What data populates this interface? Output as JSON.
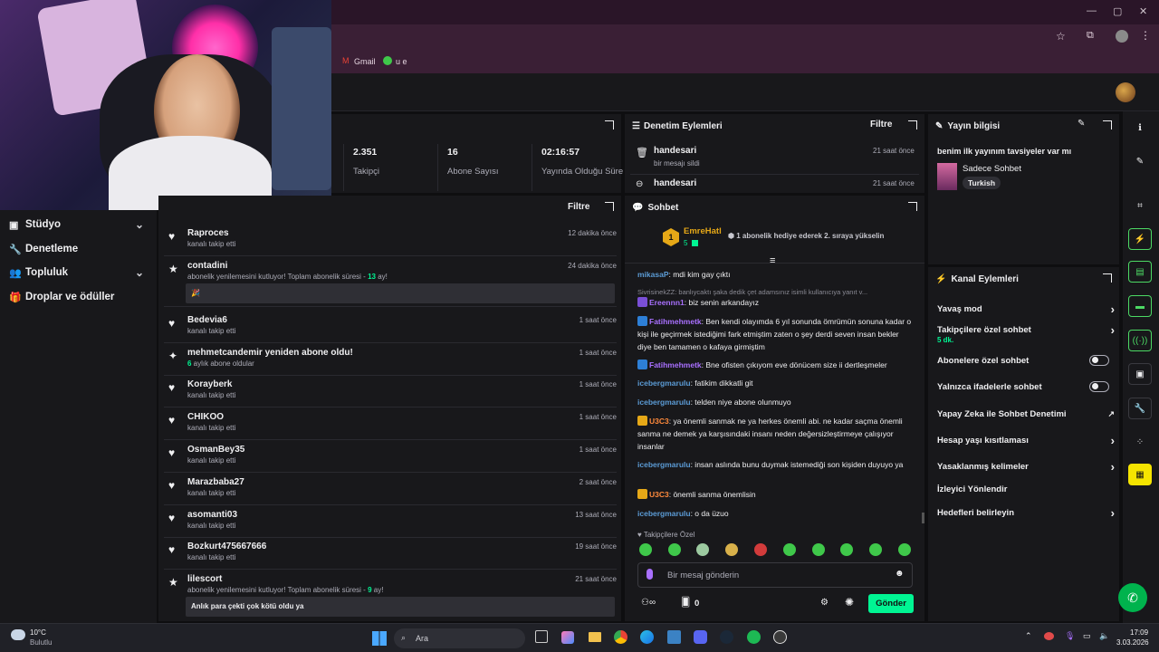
{
  "browser": {
    "bookmarks": [
      "Gmail",
      "u e"
    ]
  },
  "colors": {
    "accent": "#a970ff",
    "green": "#00f593",
    "bg": "#0e0e10",
    "panel": "#18181b"
  },
  "nav": [
    {
      "label": "Stüdyo",
      "icon": "studio-icon",
      "chevron": true
    },
    {
      "label": "Denetleme",
      "icon": "wrench-icon",
      "chevron": false
    },
    {
      "label": "Topluluk",
      "icon": "community-icon",
      "chevron": true
    },
    {
      "label": "Droplar ve ödüller",
      "icon": "gift-icon",
      "chevron": false
    }
  ],
  "stats": [
    {
      "value": "2.351",
      "label": "Takipçi"
    },
    {
      "value": "16",
      "label": "Abone Sayısı"
    },
    {
      "value": "02:16:57",
      "label": "Yayında Olduğu Süre"
    }
  ],
  "activity": {
    "filter": "Filtre",
    "items": [
      {
        "name": "Raproces",
        "sub": "kanalı takip etti",
        "time": "12 dakika önce",
        "icon": "heart-icon"
      },
      {
        "name": "contadini",
        "sub": "abonelik yenilemesini kutluyor! Toplam abonelik süresi - ",
        "sub_num": "13",
        "sub_end": " ay!",
        "time": "24 dakika önce",
        "icon": "star-icon",
        "msg": "🎉"
      },
      {
        "name": "Bedevia6",
        "sub": "kanalı takip etti",
        "time": "1 saat önce",
        "icon": "heart-icon"
      },
      {
        "name": "mehmetcandemir yeniden abone oldu!",
        "sub_num": "6",
        "sub": " aylık abone oldular",
        "time": "1 saat önce",
        "icon": "sparkle-icon"
      },
      {
        "name": "Korayberk",
        "sub": "kanalı takip etti",
        "time": "1 saat önce",
        "icon": "heart-icon"
      },
      {
        "name": "CHIKOO",
        "sub": "kanalı takip etti",
        "time": "1 saat önce",
        "icon": "heart-icon"
      },
      {
        "name": "OsmanBey35",
        "sub": "kanalı takip etti",
        "time": "1 saat önce",
        "icon": "heart-icon"
      },
      {
        "name": "Marazbaba27",
        "sub": "kanalı takip etti",
        "time": "2 saat önce",
        "icon": "heart-icon"
      },
      {
        "name": "asomanti03",
        "sub": "kanalı takip etti",
        "time": "13 saat önce",
        "icon": "heart-icon"
      },
      {
        "name": "Bozkurt475667666",
        "sub": "kanalı takip etti",
        "time": "19 saat önce",
        "icon": "heart-icon"
      },
      {
        "name": "lilescort",
        "sub": "abonelik yenilemesini kutluyor! Toplam abonelik süresi - ",
        "sub_num": "9",
        "sub_end": " ay!",
        "time": "21 saat önce",
        "icon": "star-icon",
        "msg": "Anlık para çekti çok kötü oldu ya"
      }
    ]
  },
  "moderation": {
    "title": "Denetim Eylemleri",
    "filter": "Filtre",
    "items": [
      {
        "name": "handesari",
        "sub": "bir mesajı sildi",
        "time": "21 saat önce"
      },
      {
        "name": "handesari",
        "sub": "",
        "time": "21 saat önce"
      }
    ]
  },
  "chat": {
    "title": "Sohbet",
    "gift_user": "EmreHatl",
    "gift_rank": "1",
    "gift_count": "5",
    "gift_text": "1 abonelik hediye ederek 2. sıraya yükselin",
    "messages": [
      {
        "user": "mikasaP",
        "cls": "u-blue",
        "text": ": mdi kim gay çıktı"
      },
      {
        "user": "",
        "cls": "muted",
        "text": "SivrisinekZZ: banlıycaktı şaka dedik çet adamsınız isimli kullanıcıya yanıt v..."
      },
      {
        "user": "Ereennn1",
        "cls": "u-purple",
        "text": ": biz senin arkandayız"
      },
      {
        "user": "Fatihmehmetk",
        "cls": "u-purple",
        "text": ": Ben kendi olayımda 6 yıl sonunda ömrümün sonuna kadar o kişi ile geçirmek istediğimi fark etmiştim zaten o şey derdi seven insan bekler diye ben tamamen o kafaya girmiştim"
      },
      {
        "user": "Fatihmehmetk",
        "cls": "u-purple",
        "text": ": Bne ofisten çıkıyom eve dönücem size ii dertleşmeler"
      },
      {
        "user": "icebergmarulu",
        "cls": "u-blue",
        "text": ": fatikim dikkatli git"
      },
      {
        "user": "icebergmarulu",
        "cls": "u-blue",
        "text": ": telden niye abone olunmuyo"
      },
      {
        "user": "U3C3",
        "cls": "u-orange",
        "text": ": ya önemli sanmak ne ya herkes önemli abi. ne kadar saçma önemli sanma ne demek ya karşısındaki insanı neden değersizleştirmeye çalışıyor insanlar"
      },
      {
        "user": "icebergmarulu",
        "cls": "u-blue",
        "text": ": insan aslında bunu duymak istemediği son kişiden duyuyo ya"
      },
      {
        "user": "U3C3",
        "cls": "u-orange",
        "text": ": önemli sanma önemlisin"
      },
      {
        "user": "icebergmarulu",
        "cls": "u-blue",
        "text": ": o da üzuo"
      }
    ],
    "followers_only": "Takipçilere Özel",
    "input_placeholder": "Bir mesaj gönderin",
    "points": "0",
    "send_label": "Gönder"
  },
  "stream_info": {
    "title": "Yayın bilgisi",
    "stream_title": "benim ilk yayınım tavsiyeler var mı",
    "category": "Sadece Sohbet",
    "tag": "Turkish"
  },
  "channel_actions": {
    "title": "Kanal Eylemleri",
    "items": [
      {
        "label": "Yavaş mod",
        "control": "chevron"
      },
      {
        "label": "Takipçilere özel sohbet",
        "sub": "5 dk.",
        "control": "chevron"
      },
      {
        "label": "Abonelere özel sohbet",
        "control": "toggle"
      },
      {
        "label": "Yalnızca ifadelerle sohbet",
        "control": "toggle"
      },
      {
        "label": "Yapay Zeka ile Sohbet Denetimi",
        "control": "external"
      },
      {
        "label": "Hesap yaşı kısıtlaması",
        "control": "chevron"
      },
      {
        "label": "Yasaklanmış kelimeler",
        "control": "chevron"
      },
      {
        "label": "İzleyici Yönlendir",
        "control": "none"
      },
      {
        "label": "Hedefleri belirleyin",
        "control": "chevron"
      }
    ]
  },
  "taskbar": {
    "weather_temp": "10°C",
    "weather_text": "Bulutlu",
    "search": "Ara",
    "time": "17:09",
    "date": "3.03.2026"
  }
}
